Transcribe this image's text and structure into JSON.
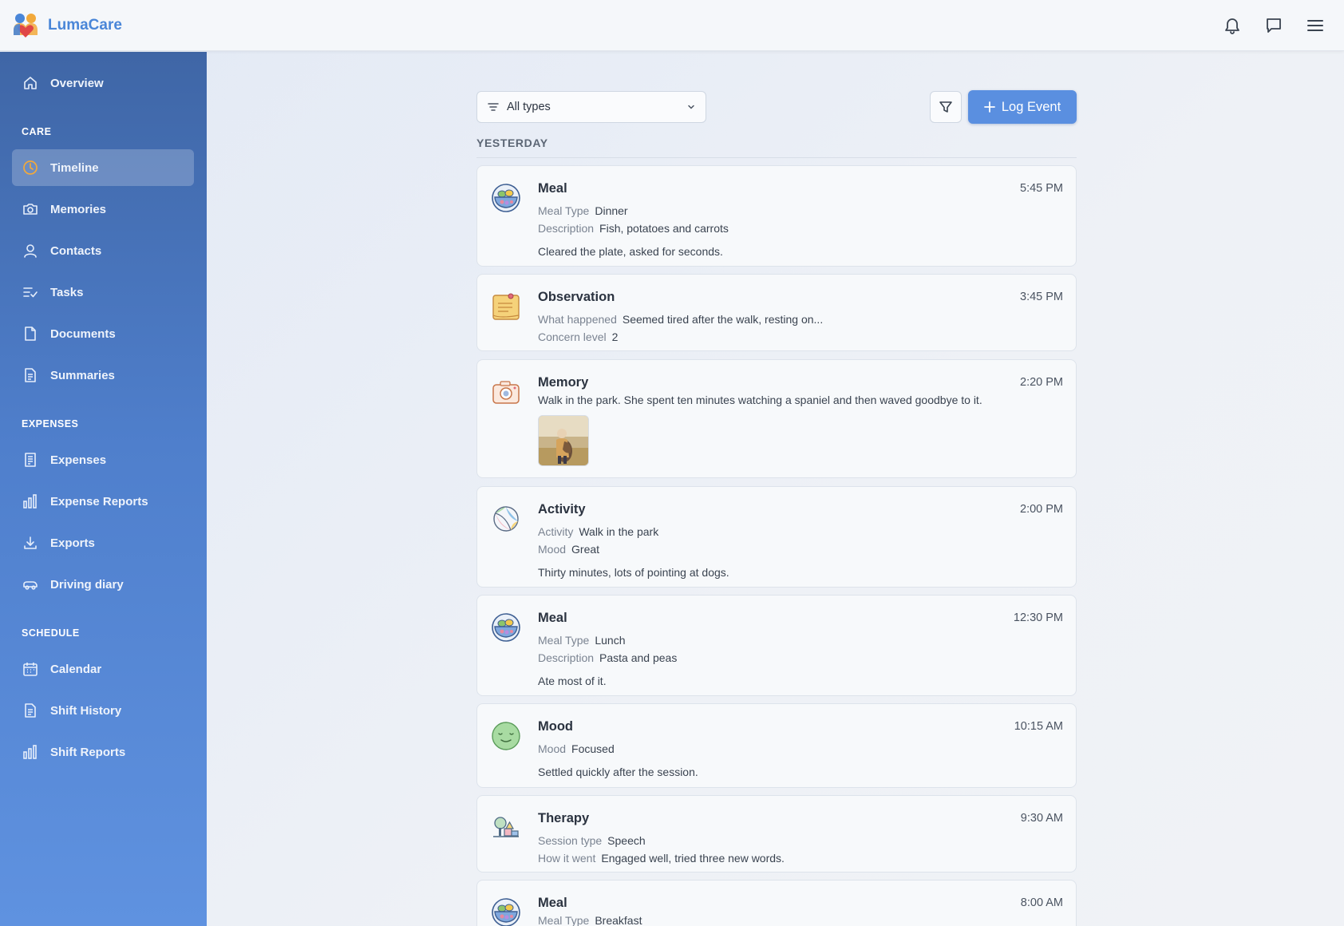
{
  "app": {
    "name": "LumaCare"
  },
  "header": {
    "icons": [
      "bell-icon",
      "chat-icon",
      "menu-icon"
    ]
  },
  "sidebar": {
    "overview": "Overview",
    "sections": {
      "care": "CARE",
      "expenses": "EXPENSES",
      "schedule": "SCHEDULE"
    },
    "care_items": [
      "Timeline",
      "Memories",
      "Contacts",
      "Tasks",
      "Documents",
      "Summaries"
    ],
    "expense_items": [
      "Expenses",
      "Expense Reports",
      "Exports",
      "Driving diary"
    ],
    "schedule_items": [
      "Calendar",
      "Shift History",
      "Shift Reports"
    ],
    "active": "Timeline"
  },
  "toolbar": {
    "filter_value": "All types",
    "log_button": "Log Event"
  },
  "timeline": {
    "day_label": "YESTERDAY",
    "events": [
      {
        "type": "Meal",
        "time": "5:45 PM",
        "icon": "meal-bowl-icon",
        "fields": [
          {
            "k": "Meal Type",
            "v": "Dinner"
          },
          {
            "k": "Description",
            "v": "Fish, potatoes and carrots"
          }
        ],
        "note": "Cleared the plate, asked for seconds."
      },
      {
        "type": "Observation",
        "time": "3:45 PM",
        "icon": "sticky-note-icon",
        "fields": [
          {
            "k": "What happened",
            "v": "Seemed tired after the walk, resting on..."
          },
          {
            "k": "Concern level",
            "v": "2"
          }
        ],
        "note": ""
      },
      {
        "type": "Memory",
        "time": "2:20 PM",
        "icon": "camera-icon",
        "text": "Walk in the park. She spent ten minutes watching a spaniel and then waved goodbye to it."
      },
      {
        "type": "Activity",
        "time": "2:00 PM",
        "icon": "beach-ball-icon",
        "fields": [
          {
            "k": "Activity",
            "v": "Walk in the park"
          },
          {
            "k": "Mood",
            "v": "Great"
          }
        ],
        "note": "Thirty minutes, lots of pointing at dogs."
      },
      {
        "type": "Meal",
        "time": "12:30 PM",
        "icon": "meal-bowl-icon",
        "fields": [
          {
            "k": "Meal Type",
            "v": "Lunch"
          },
          {
            "k": "Description",
            "v": "Pasta and peas"
          }
        ],
        "note": "Ate most of it."
      },
      {
        "type": "Mood",
        "time": "10:15 AM",
        "icon": "smiley-face-icon",
        "fields": [
          {
            "k": "Mood",
            "v": "Focused"
          }
        ],
        "note": "Settled quickly after the session."
      },
      {
        "type": "Therapy",
        "time": "9:30 AM",
        "icon": "therapy-blocks-icon",
        "fields": [
          {
            "k": "Session type",
            "v": "Speech"
          },
          {
            "k": "How it went",
            "v": "Engaged well, tried three new words."
          }
        ],
        "note": ""
      },
      {
        "type": "Meal",
        "time": "8:00 AM",
        "icon": "meal-bowl-icon",
        "fields": [
          {
            "k": "Meal Type",
            "v": "Breakfast"
          }
        ],
        "note": ""
      }
    ]
  },
  "colors": {
    "accent": "#5a8fe0",
    "brand": "#4a86d8",
    "sidebar_top": "#3f66a6",
    "sidebar_bottom": "#5f92e0",
    "active_icon": "#f2a93b"
  }
}
